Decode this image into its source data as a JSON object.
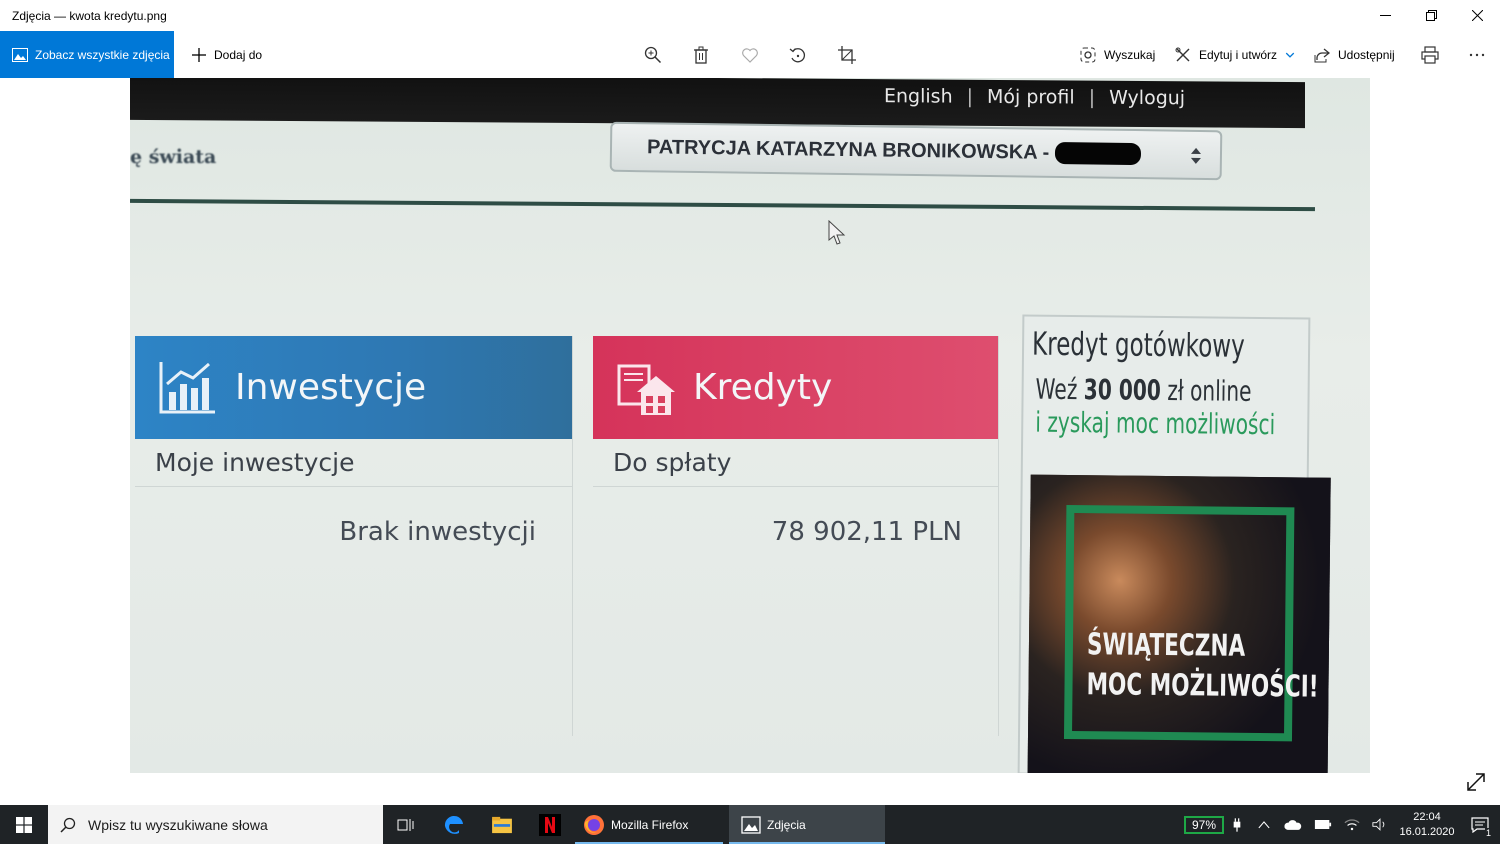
{
  "window": {
    "title": "Zdjęcia — kwota kredytu.png"
  },
  "toolbar": {
    "see_all_label": "Zobacz wszystkie zdjęcia",
    "add_to_label": "Dodaj do",
    "search_label": "Wyszukaj",
    "edit_label": "Edytuj i utwórz",
    "share_label": "Udostępnij"
  },
  "photo": {
    "top_links": [
      "English",
      "|",
      "Mój profil",
      "|",
      "Wyloguj"
    ],
    "brand_fragment": "ę świata",
    "account_name": "PATRYCJA KATARZYNA BRONIKOWSKA -",
    "investments": {
      "title": "Inwestycje",
      "subtitle": "Moje inwestycje",
      "value": "Brak inwestycji"
    },
    "credits": {
      "title": "Kredyty",
      "subtitle": "Do spłaty",
      "value": "78 902,11 PLN"
    },
    "ad": {
      "headline": "Kredyt gotówkowy",
      "line2_prefix": "Weź ",
      "line2_amount": "30 000",
      "line2_suffix": " zł online",
      "line3": "i zyskaj moc możliwości",
      "promo_line1": "ŚWIĄTECZNA",
      "promo_line2": "MOC MOŻLIWOŚCI!"
    }
  },
  "taskbar": {
    "search_placeholder": "Wpisz tu wyszukiwane słowa",
    "apps": [
      {
        "label": "Mozilla Firefox"
      },
      {
        "label": "Zdjęcia"
      }
    ],
    "battery": "97%",
    "time": "22:04",
    "date": "16.01.2020",
    "notifications": "1"
  },
  "colors": {
    "accent": "#0078d7",
    "investments": "#2e7fbd",
    "credits": "#d9405f",
    "taskbar": "#1f2326"
  }
}
